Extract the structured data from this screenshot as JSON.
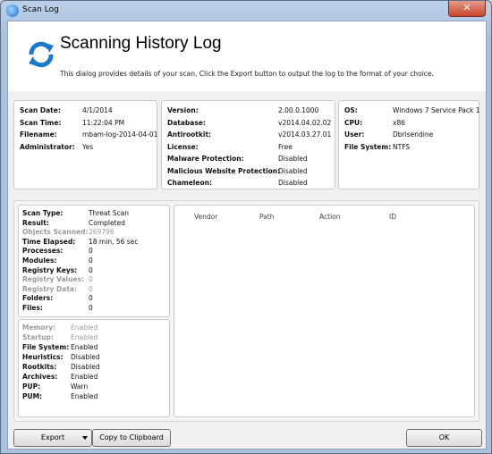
{
  "window": {
    "title": "Scan Log",
    "close_label": "✕"
  },
  "header": {
    "title": "Scanning History Log",
    "subtitle": "This dialog provides details of your scan.  Click the Export button to output the log to the format of your choice."
  },
  "scan_info": [
    {
      "label": "Scan Date:",
      "value": "4/1/2014"
    },
    {
      "label": "Scan Time:",
      "value": "11:22:04 PM"
    },
    {
      "label": "Filename:",
      "value": "mbam-log-2014-04-01"
    },
    {
      "label": "Administrator:",
      "value": "Yes"
    }
  ],
  "version_info": [
    {
      "label": "Version:",
      "value": "2.00.0.1000"
    },
    {
      "label": "Database:",
      "value": "v2014.04.02.02"
    },
    {
      "label": "Antirootkit:",
      "value": "v2014.03.27.01"
    },
    {
      "label": "License:",
      "value": "Free"
    },
    {
      "label": "Malware Protection:",
      "value": "Disabled"
    },
    {
      "label": "Malicious Website Protection:",
      "value": "Disabled"
    },
    {
      "label": "Chameleon:",
      "value": "Disabled"
    }
  ],
  "system_info": [
    {
      "label": "OS:",
      "value": "Windows 7 Service Pack 1"
    },
    {
      "label": "CPU:",
      "value": "x86"
    },
    {
      "label": "User:",
      "value": "Dbrisendine"
    },
    {
      "label": "File System:",
      "value": "NTFS"
    }
  ],
  "scan_stats": [
    {
      "label": "Scan Type:",
      "value": "Threat Scan"
    },
    {
      "label": "Result:",
      "value": "Completed"
    },
    {
      "label": "Objects Scanned:",
      "value": "269796"
    },
    {
      "label": "Time Elapsed:",
      "value": "18 min, 56 sec"
    },
    {
      "label": "Processes:",
      "value": "0"
    },
    {
      "label": "Modules:",
      "value": "0"
    },
    {
      "label": "Registry Keys:",
      "value": "0"
    },
    {
      "label": "Registry Values:",
      "value": "0"
    },
    {
      "label": "Registry Data:",
      "value": "0"
    },
    {
      "label": "Folders:",
      "value": "0"
    },
    {
      "label": "Files:",
      "value": "0"
    }
  ],
  "scan_options": [
    {
      "label": "Memory:",
      "value": "Enabled"
    },
    {
      "label": "Startup:",
      "value": "Enabled"
    },
    {
      "label": "File System:",
      "value": "Enabled"
    },
    {
      "label": "Heuristics:",
      "value": "Disabled"
    },
    {
      "label": "Rootkits:",
      "value": "Disabled"
    },
    {
      "label": "Archives:",
      "value": "Enabled"
    },
    {
      "label": "PUP:",
      "value": "Warn"
    },
    {
      "label": "PUM:",
      "value": "Enabled"
    }
  ],
  "results_table": {
    "columns": [
      "Vendor",
      "Path",
      "Action",
      "ID"
    ]
  },
  "buttons": {
    "export": "Export",
    "copy": "Copy to Clipboard",
    "ok": "OK"
  }
}
